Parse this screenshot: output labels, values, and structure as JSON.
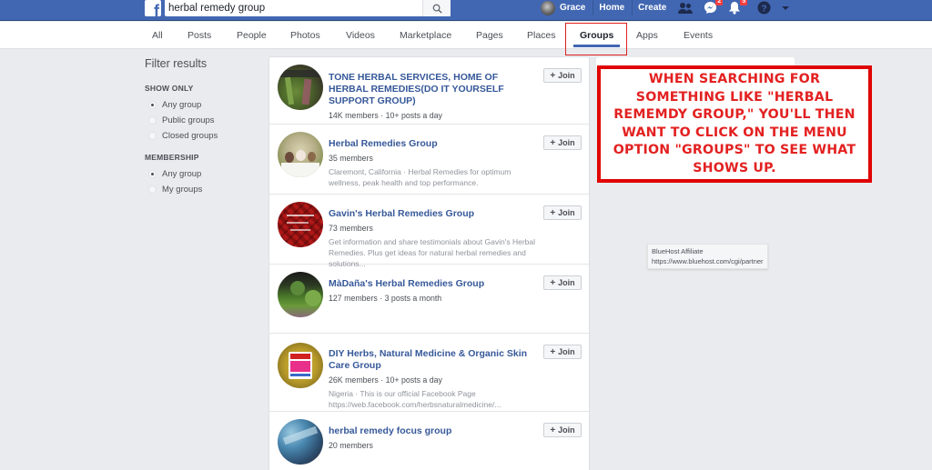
{
  "topbar": {
    "logo": "f",
    "search_value": "herbal remedy group",
    "search_placeholder": "Search",
    "user_name": "Grace",
    "home_label": "Home",
    "create_label": "Create",
    "icons": [
      "friend-requests-icon",
      "messenger-icon",
      "notifications-icon",
      "help-icon",
      "caret-down-icon"
    ],
    "messenger_badge": "2",
    "notifications_badge": "5"
  },
  "tabs": [
    {
      "label": "All"
    },
    {
      "label": "Posts"
    },
    {
      "label": "People"
    },
    {
      "label": "Photos"
    },
    {
      "label": "Videos"
    },
    {
      "label": "Marketplace"
    },
    {
      "label": "Pages"
    },
    {
      "label": "Places"
    },
    {
      "label": "Groups",
      "active": true
    },
    {
      "label": "Apps"
    },
    {
      "label": "Events"
    }
  ],
  "filter": {
    "title": "Filter results",
    "show_only": {
      "heading": "SHOW ONLY",
      "options": [
        {
          "label": "Any group",
          "checked": true
        },
        {
          "label": "Public groups",
          "checked": false
        },
        {
          "label": "Closed groups",
          "checked": false
        }
      ]
    },
    "membership": {
      "heading": "MEMBERSHIP",
      "options": [
        {
          "label": "Any group",
          "checked": true
        },
        {
          "label": "My groups",
          "checked": false
        }
      ]
    }
  },
  "results": [
    {
      "title": "TONE HERBAL SERVICES, HOME OF HERBAL REMEDIES(DO IT YOURSELF SUPPORT GROUP)",
      "meta": "14K members · 10+ posts a day",
      "desc": "",
      "join_label": "Join"
    },
    {
      "title": "Herbal Remedies Group",
      "meta": "35 members",
      "desc": "Claremont, California · Herbal Remedies for optimum wellness, peak health and top performance.",
      "join_label": "Join"
    },
    {
      "title": "Gavin's Herbal Remedies Group",
      "meta": "73 members",
      "desc": "Get information and share testimonials about Gavin's Herbal Remedies. Plus get ideas for natural herbal remedies and solutions...",
      "join_label": "Join"
    },
    {
      "title": "MàDaña's Herbal Remedies Group",
      "meta": "127 members · 3 posts a month",
      "desc": "",
      "join_label": "Join"
    },
    {
      "title": "DIY Herbs, Natural Medicine & Organic Skin Care Group",
      "meta": "26K members · 10+ posts a day",
      "desc": "Nigeria · This is our official Facebook Page https://web.facebook.com/herbsnaturalmedicine/...",
      "join_label": "Join"
    },
    {
      "title": "herbal remedy focus group",
      "meta": "20 members",
      "desc": "",
      "join_label": "Join"
    }
  ],
  "callout": {
    "text": "WHEN SEARCHING FOR SOMETHING LIKE \"HERBAL REMEMDY GROUP,\" YOU'LL THEN WANT TO CLICK ON THE MENU OPTION \"GROUPS\" TO SEE WHAT SHOWS UP."
  },
  "tooltip": {
    "line1": "BlueHost Affiliate",
    "line2": "https://www.bluehost.com/cgi/partner"
  },
  "colors": {
    "brand_blue": "#4267b2",
    "link_blue": "#365899",
    "annotation_red": "#e00000"
  }
}
